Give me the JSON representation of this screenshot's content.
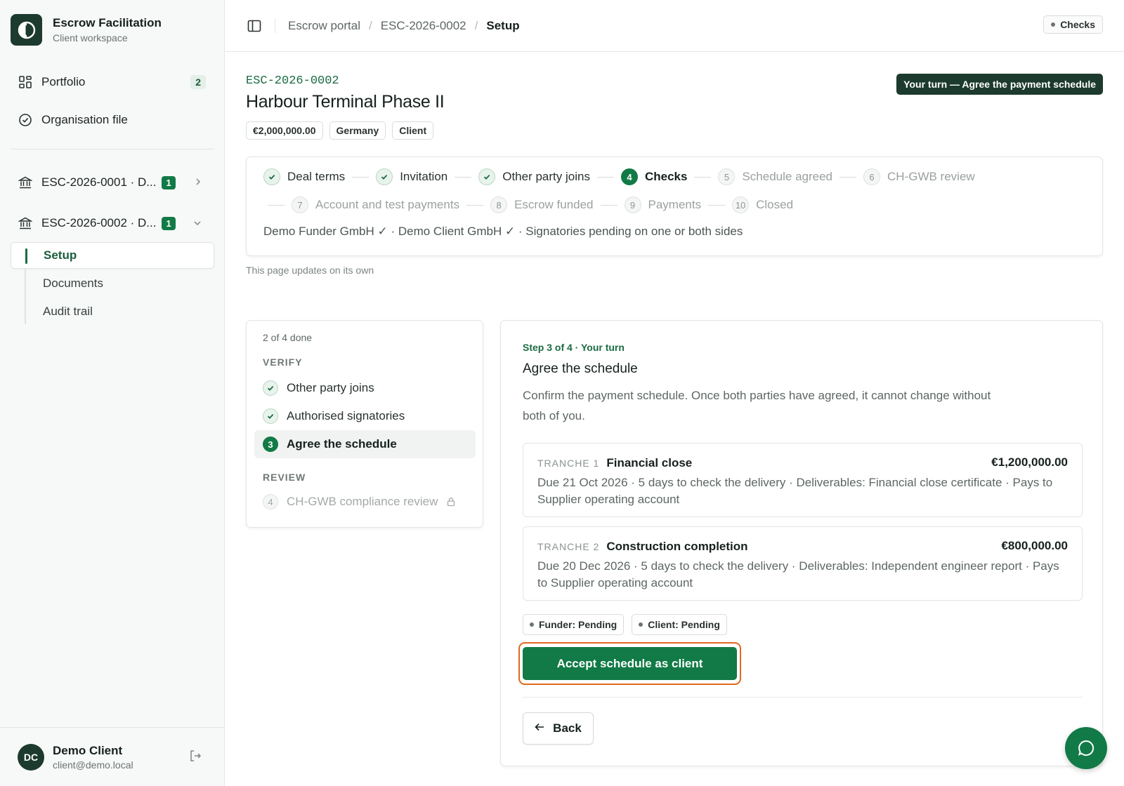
{
  "sidebar": {
    "brand_title": "Escrow Facilitation",
    "brand_sub": "Client workspace",
    "portfolio_label": "Portfolio",
    "portfolio_count": "2",
    "org_label": "Organisation file",
    "cases": [
      {
        "label": "ESC-2026-0001 · D...",
        "count": "1"
      },
      {
        "label": "ESC-2026-0002 · D...",
        "count": "1"
      }
    ],
    "sub_items": [
      "Setup",
      "Documents",
      "Audit trail"
    ],
    "user": {
      "initials": "DC",
      "name": "Demo Client",
      "email": "client@demo.local"
    }
  },
  "topbar": {
    "breadcrumb": [
      "Escrow portal",
      "ESC-2026-0002",
      "Setup"
    ],
    "status_pill": "Checks"
  },
  "case": {
    "id": "ESC-2026-0002",
    "title": "Harbour Terminal Phase II",
    "tags": [
      "€2,000,000.00",
      "Germany",
      "Client"
    ],
    "turn_badge": "Your turn — Agree the payment schedule"
  },
  "stepper": {
    "steps": [
      {
        "num": "1",
        "label": "Deal terms",
        "state": "done"
      },
      {
        "num": "2",
        "label": "Invitation",
        "state": "done"
      },
      {
        "num": "3",
        "label": "Other party joins",
        "state": "done"
      },
      {
        "num": "4",
        "label": "Checks",
        "state": "current"
      },
      {
        "num": "5",
        "label": "Schedule agreed",
        "state": "todo"
      },
      {
        "num": "6",
        "label": "CH-GWB review",
        "state": "todo"
      },
      {
        "num": "7",
        "label": "Account and test payments",
        "state": "todo"
      },
      {
        "num": "8",
        "label": "Escrow funded",
        "state": "todo"
      },
      {
        "num": "9",
        "label": "Payments",
        "state": "todo"
      },
      {
        "num": "10",
        "label": "Closed",
        "state": "todo"
      }
    ],
    "note": "Demo Funder GmbH ✓ · Demo Client GmbH ✓ · Signatories pending on one or both sides",
    "updates": "This page updates on its own"
  },
  "checklist": {
    "progress": "2 of 4 done",
    "verify_heading": "VERIFY",
    "review_heading": "REVIEW",
    "items": [
      {
        "num": "1",
        "label": "Other party joins",
        "state": "done"
      },
      {
        "num": "2",
        "label": "Authorised signatories",
        "state": "done"
      },
      {
        "num": "3",
        "label": "Agree the schedule",
        "state": "current"
      },
      {
        "num": "4",
        "label": "CH-GWB compliance review",
        "state": "locked"
      }
    ]
  },
  "step": {
    "eyebrow": "Step 3 of 4 · Your turn",
    "title": "Agree the schedule",
    "description": "Confirm the payment schedule. Once both parties have agreed, it cannot change without both of you.",
    "tranches": [
      {
        "label": "TRANCHE 1",
        "name": "Financial close",
        "amount": "€1,200,000.00",
        "details": "Due 21 Oct 2026 · 5 days to check the delivery · Deliverables: Financial close certificate · Pays to Supplier operating account"
      },
      {
        "label": "TRANCHE 2",
        "name": "Construction completion",
        "amount": "€800,000.00",
        "details": "Due 20 Dec 2026 · 5 days to check the delivery · Deliverables: Independent engineer report · Pays to Supplier operating account"
      }
    ],
    "funder_status": "Funder: Pending",
    "client_status": "Client: Pending",
    "accept_label": "Accept schedule as client",
    "back_label": "Back"
  },
  "colors": {
    "accent": "#117a46",
    "brand_dark": "#1d3a2e",
    "highlight": "#e0691f"
  }
}
